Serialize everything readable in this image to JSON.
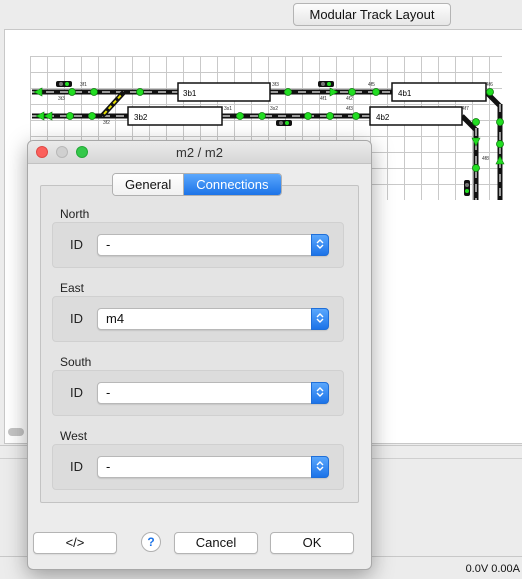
{
  "background": {
    "title_button": "Modular Track Layout",
    "track_labels": [
      "3b1",
      "4b1",
      "3b2",
      "4b2",
      "3f1",
      "3f2",
      "3f3",
      "4f1",
      "4f2",
      "4f3",
      "4f5",
      "4f6",
      "4f7",
      "4f8",
      "3t3",
      "3s1",
      "3s2"
    ],
    "status": "0.0V 0.00A"
  },
  "dialog": {
    "title": "m2 / m2",
    "tabs": {
      "general": "General",
      "connections": "Connections"
    },
    "sections": [
      {
        "title": "North",
        "id_label": "ID",
        "value": "-"
      },
      {
        "title": "East",
        "id_label": "ID",
        "value": "m4"
      },
      {
        "title": "South",
        "id_label": "ID",
        "value": "-"
      },
      {
        "title": "West",
        "id_label": "ID",
        "value": "-"
      }
    ],
    "buttons": {
      "xml": "</>",
      "help": "?",
      "cancel": "Cancel",
      "ok": "OK"
    }
  },
  "colors": {
    "accent": "#1c73e8",
    "signal_green": "#22dd22"
  }
}
